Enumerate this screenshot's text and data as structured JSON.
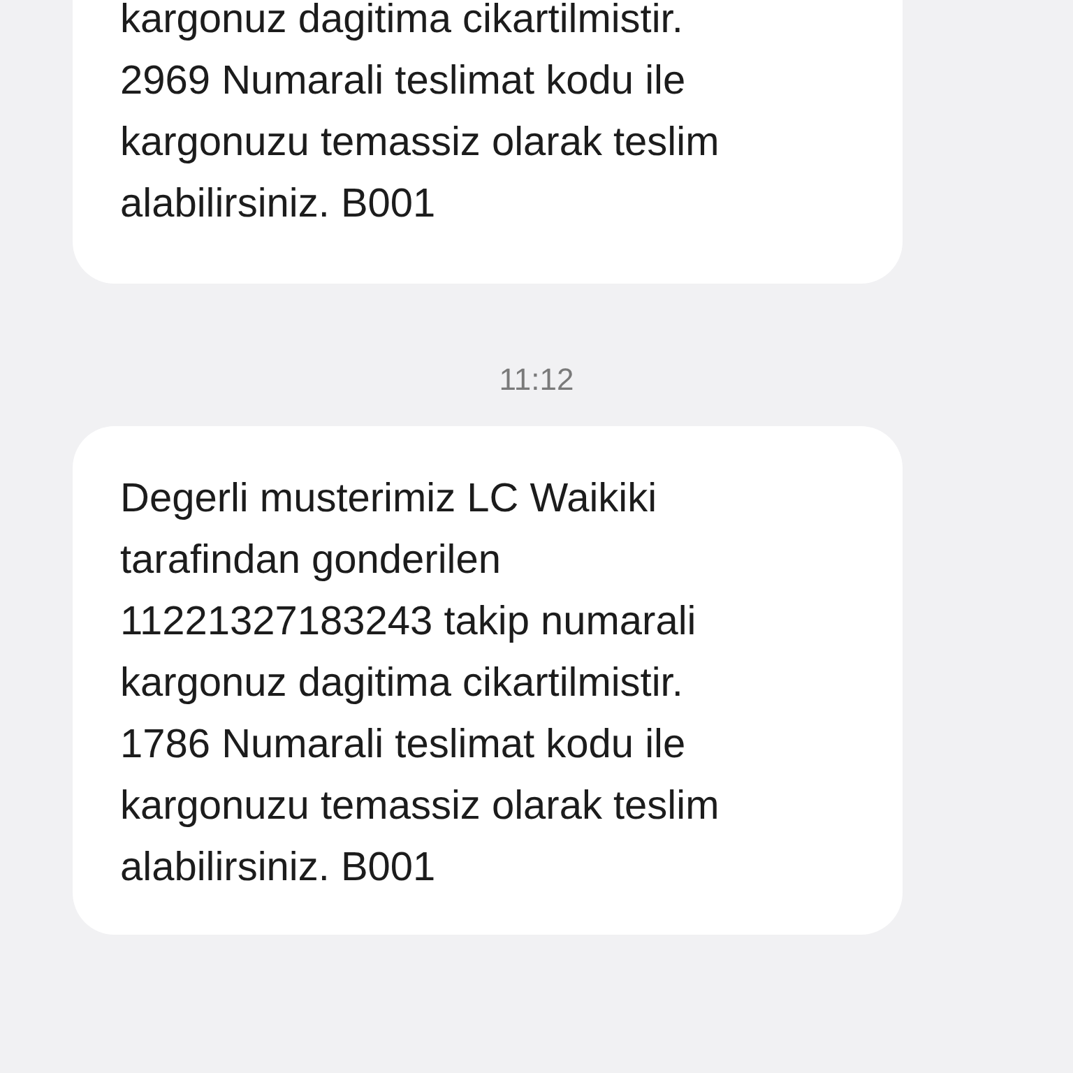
{
  "messages": [
    {
      "kind": "bubble",
      "cut_top": true,
      "text": "kargonuz dagitima cikartilmistir.\n2969 Numarali teslimat kodu ile\nkargonuzu temassiz olarak teslim\nalabilirsiniz. B001"
    },
    {
      "kind": "time",
      "text": "11:12"
    },
    {
      "kind": "bubble",
      "cut_top": false,
      "text": "Degerli musterimiz LC Waikiki\ntarafindan gonderilen\n11221327183243 takip numarali\nkargonuz dagitima cikartilmistir.\n1786 Numarali teslimat kodu ile\nkargonuzu temassiz olarak teslim\nalabilirsiniz. B001"
    }
  ]
}
